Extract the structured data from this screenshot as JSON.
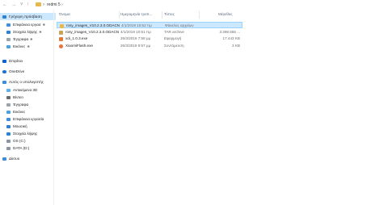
{
  "address_bar": {
    "back_icon": "arrow-left-icon",
    "forward_icon": "arrow-right-icon",
    "up_icon": "arrow-up-icon",
    "separator": "›",
    "path": "redmi 5",
    "path_dropdown": "›"
  },
  "sidebar": {
    "items": [
      {
        "label": "Γρήγορη πρόσβαση",
        "icon": "star-icon",
        "pinned": false,
        "selected": true
      },
      {
        "label": "Επιφάνεια εργασ",
        "icon": "desktop-icon",
        "pinned": true
      },
      {
        "label": "Στοιχεία λήψης",
        "icon": "download-icon",
        "pinned": true
      },
      {
        "label": "Έγγραφα",
        "icon": "documents-icon",
        "pinned": true
      },
      {
        "label": "Εικόνες",
        "icon": "pictures-icon",
        "pinned": true
      },
      {
        "label": "Dropbox",
        "icon": "dropbox-icon"
      },
      {
        "label": "OneDrive",
        "icon": "cloud-icon"
      },
      {
        "label": "Αυτός ο υπολογιστής",
        "icon": "computer-icon"
      },
      {
        "label": "Αντικείμενα 3D",
        "icon": "cube-icon"
      },
      {
        "label": "Βίντεο",
        "icon": "video-icon"
      },
      {
        "label": "Έγγραφα",
        "icon": "documents-icon"
      },
      {
        "label": "Εικόνες",
        "icon": "pictures-icon"
      },
      {
        "label": "Επιφάνεια εργασία",
        "icon": "desktop-icon"
      },
      {
        "label": "Μουσική",
        "icon": "music-icon"
      },
      {
        "label": "Στοιχεία λήψης",
        "icon": "download-icon"
      },
      {
        "label": "OS (C:)",
        "icon": "drive-icon"
      },
      {
        "label": "DATA (D:)",
        "icon": "drive-icon"
      },
      {
        "label": "Δίκτυο",
        "icon": "network-icon"
      }
    ]
  },
  "columns": {
    "name": "Όνομα",
    "date": "Ημερομηνία τροπ...",
    "type": "Τύπος",
    "size": "Μέγεθος"
  },
  "files": [
    {
      "name": "rosy_images_V10.2.3.0.ODACNXM_20190...",
      "date": "4/1/2019 10:52 πμ",
      "type": "Φάκελος αρχείων",
      "size": "",
      "icon": "folder-icon",
      "selected": true
    },
    {
      "name": "rosy_images_V10.2.3.0.ODACNXM_20190...",
      "date": "4/1/2019 10:51 πμ",
      "type": "TAR archive",
      "size": "3.398.555 ...",
      "icon": "archive-icon"
    },
    {
      "name": "xdi_1.0.3.exe",
      "date": "26/3/2019 7:58 μμ",
      "type": "Εφαρμογή",
      "size": "17.443 KB",
      "icon": "exe-icon"
    },
    {
      "name": "XiaomiFlash.exe",
      "date": "26/3/2019 9:57 μμ",
      "type": "Συντόμευση",
      "size": "3 KB",
      "icon": "shortcut-icon"
    }
  ],
  "colors": {
    "selection": "#cce8ff",
    "selection_border": "#99d1ff",
    "folder": "#e8b94a",
    "header_text": "#5b6b7d"
  }
}
